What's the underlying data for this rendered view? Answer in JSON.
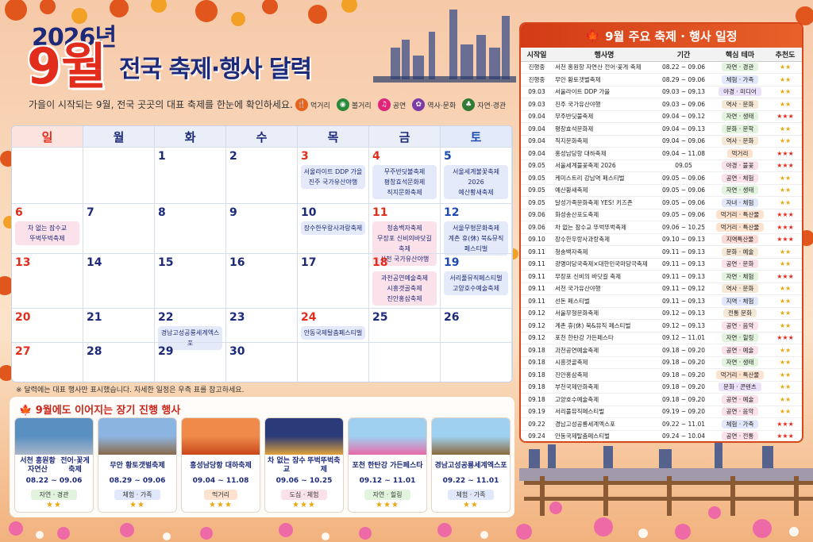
{
  "header": {
    "year": "2026년",
    "month": "9월",
    "title": "전국 축제·행사 달력",
    "subtitle": "가을이 시작되는 9월, 전국 곳곳의 대표 축제를 한눈에 확인하세요."
  },
  "legend": [
    {
      "label": "먹거리",
      "icon": "food-icon",
      "color": "#e8631a",
      "glyph": "🍴"
    },
    {
      "label": "볼거리",
      "icon": "binoculars-icon",
      "color": "#2a8a3a",
      "glyph": "◉"
    },
    {
      "label": "공연",
      "icon": "music-icon",
      "color": "#e0247a",
      "glyph": "♫"
    },
    {
      "label": "역사·문화",
      "icon": "palette-icon",
      "color": "#7a3aa8",
      "glyph": "✿"
    },
    {
      "label": "자연·경관",
      "icon": "tree-icon",
      "color": "#2f7a34",
      "glyph": "♣"
    }
  ],
  "calendar": {
    "weekdays": [
      "일",
      "월",
      "화",
      "수",
      "목",
      "금",
      "토"
    ],
    "days": [
      {
        "d": "",
        "t": ""
      },
      {
        "d": "",
        "t": ""
      },
      {
        "d": "1",
        "t": ""
      },
      {
        "d": "2",
        "t": ""
      },
      {
        "d": "3",
        "t": "hol",
        "ev": "서울라이트 DDP 가을\n진주 국가유산야행",
        "c": "blue"
      },
      {
        "d": "4",
        "t": "hol",
        "ev": "무주반딧불축제\n평창효석문화제\n직지문화축제",
        "c": "blue"
      },
      {
        "d": "5",
        "t": "sat",
        "ev": "서울세계불꽃축제 2026\n예산황새축제",
        "c": "blue"
      },
      {
        "d": "6",
        "t": "sun",
        "ev": "차 없는 잠수교\n뚜벅뚜벅축제",
        "c": "pink"
      },
      {
        "d": "7",
        "t": ""
      },
      {
        "d": "8",
        "t": ""
      },
      {
        "d": "9",
        "t": ""
      },
      {
        "d": "10",
        "t": "",
        "ev": "장수한우랑사과랑축제",
        "c": "blue"
      },
      {
        "d": "11",
        "t": "hol",
        "ev": "청송백자축제\n무장포 신비의바닷길 축제\n서천 국가유산야행",
        "c": "pink"
      },
      {
        "d": "12",
        "t": "sat",
        "ev": "서울무형문화축제\n계촌 휴(休) 북&뮤직\n페스티벌",
        "c": "blue"
      },
      {
        "d": "13",
        "t": "sun"
      },
      {
        "d": "14",
        "t": ""
      },
      {
        "d": "15",
        "t": ""
      },
      {
        "d": "16",
        "t": ""
      },
      {
        "d": "17",
        "t": ""
      },
      {
        "d": "18",
        "t": "hol",
        "ev": "과천공연예술축제\n시흥갯골축제\n진안홍삼축제",
        "c": "pink"
      },
      {
        "d": "19",
        "t": "sat",
        "ev": "서리풀뮤직페스티벌\n고양호수예술축제",
        "c": "blue"
      },
      {
        "d": "20",
        "t": "sun"
      },
      {
        "d": "21",
        "t": ""
      },
      {
        "d": "22",
        "t": "",
        "ev": "경남고성공룡세계엑스포",
        "c": "blue"
      },
      {
        "d": "23",
        "t": ""
      },
      {
        "d": "24",
        "t": "hol",
        "ev": "안동국제탈춤페스티벌",
        "c": "blue"
      },
      {
        "d": "25",
        "t": ""
      },
      {
        "d": "26",
        "t": ""
      },
      {
        "d": "27",
        "t": "sun"
      },
      {
        "d": "28",
        "t": ""
      },
      {
        "d": "29",
        "t": ""
      },
      {
        "d": "30",
        "t": ""
      },
      {
        "d": "",
        "t": ""
      },
      {
        "d": "",
        "t": ""
      },
      {
        "d": "",
        "t": ""
      }
    ]
  },
  "note": "※ 달력에는 대표 행사만 표시했습니다. 자세한 일정은 우측 표를 참고하세요.",
  "long_events": {
    "title": "9월에도 이어지는 장기 진행 행사",
    "items": [
      {
        "name": "서천 홍원항 자연산\n전어·꽃게 축제",
        "date": "08.22 ~ 09.06",
        "theme": "자연 · 경관",
        "stars": "★★",
        "theme_color": "#e3f4de",
        "img": "fish"
      },
      {
        "name": "무안 황토갯벌축제",
        "date": "08.29 ~ 09.06",
        "theme": "체험 · 가족",
        "stars": "★★",
        "theme_color": "#e1e8fb",
        "img": "mudflat"
      },
      {
        "name": "홍성남당항 대하축제",
        "date": "09.04 ~ 11.08",
        "theme": "먹거리",
        "stars": "★★★",
        "theme_color": "#fde3cf",
        "img": "shrimp"
      },
      {
        "name": "차 없는 잠수교\n뚜벅뚜벅축제",
        "date": "09.06 ~ 10.25",
        "theme": "도심 · 체험",
        "stars": "★★★",
        "theme_color": "#fbe1ea",
        "img": "bridge"
      },
      {
        "name": "포천 한탄강 가든페스타",
        "date": "09.12 ~ 11.01",
        "theme": "자연 · 힐링",
        "stars": "★★★",
        "theme_color": "#e3f4de",
        "img": "garden"
      },
      {
        "name": "경남고성공룡세계엑스포",
        "date": "09.22 ~ 11.01",
        "theme": "체험 · 가족",
        "stars": "★★",
        "theme_color": "#e1e8fb",
        "img": "dino"
      }
    ]
  },
  "schedule": {
    "title": "9월 주요 축제 · 행사 일정",
    "columns": [
      "시작일",
      "행사명",
      "기간",
      "핵심 테마",
      "추천도"
    ],
    "rows": [
      [
        "진행중",
        "서천 홍원항 자연산 전어·꽃게 축제",
        "08.22 ~ 09.06",
        "자연 · 경관",
        "★★",
        "t-green",
        ""
      ],
      [
        "진행중",
        "무안 황토갯벌축제",
        "08.29 ~ 09.06",
        "체험 · 가족",
        "★★",
        "t-blue",
        ""
      ],
      [
        "09.03",
        "서울라이트 DDP 가을",
        "09.03 ~ 09.13",
        "야경 · 미디어",
        "★★",
        "t-purple",
        ""
      ],
      [
        "09.03",
        "진주 국가유산야행",
        "09.03 ~ 09.06",
        "역사 · 문화",
        "★★",
        "t-brown",
        ""
      ],
      [
        "09.04",
        "무주반딧불축제",
        "09.04 ~ 09.12",
        "자연 · 생태",
        "★★★",
        "t-green",
        "red"
      ],
      [
        "09.04",
        "평창효석문화제",
        "09.04 ~ 09.13",
        "문화 · 문학",
        "★★",
        "t-green",
        ""
      ],
      [
        "09.04",
        "직지문화축제",
        "09.04 ~ 09.06",
        "역사 · 문화",
        "★★",
        "t-brown",
        ""
      ],
      [
        "09.04",
        "홍성남당항 대하축제",
        "09.04 ~ 11.08",
        "먹거리",
        "★★★",
        "t-orange",
        "red"
      ],
      [
        "09.05",
        "서울세계불꽃축제 2026",
        "09.05",
        "야경 · 불꽃",
        "★★★",
        "t-pink",
        "red"
      ],
      [
        "09.05",
        "케미스트리 강남역 페스티벌",
        "09.05 ~ 09.06",
        "공연 · 체험",
        "★★",
        "t-pink",
        ""
      ],
      [
        "09.05",
        "예산황새축제",
        "09.05 ~ 09.06",
        "자연 · 생태",
        "★★",
        "t-green",
        ""
      ],
      [
        "09.05",
        "달성가족문화축제 YES! 키즈존",
        "09.05 ~ 09.06",
        "자녀 · 체험",
        "★★",
        "t-blue",
        ""
      ],
      [
        "09.06",
        "화성송산포도축제",
        "09.05 ~ 09.06",
        "먹거리 · 특산물",
        "★★★",
        "t-orange",
        "red"
      ],
      [
        "09.06",
        "차 없는 잠수교 뚜벅뚜벅축제",
        "09.06 ~ 10.25",
        "먹거리 · 특산물",
        "★★★",
        "t-orange",
        "red"
      ],
      [
        "09.10",
        "장수한우랑사과랑축제",
        "09.10 ~ 09.13",
        "지역특산물",
        "★★★",
        "t-red",
        "red"
      ],
      [
        "09.11",
        "청송백자축제",
        "09.11 ~ 09.13",
        "문화 · 예술",
        "★★",
        "t-brown",
        ""
      ],
      [
        "09.11",
        "광명미당국축제×대한민국마당극축제",
        "09.11 ~ 09.13",
        "공연 · 문화",
        "★★",
        "t-pink",
        ""
      ],
      [
        "09.11",
        "무장포 신비의 바닷길 축제",
        "09.11 ~ 09.13",
        "자연 · 체험",
        "★★★",
        "t-green",
        "red"
      ],
      [
        "09.11",
        "서천 국가유산야행",
        "09.11 ~ 09.12",
        "역사 · 문화",
        "★★",
        "t-brown",
        ""
      ],
      [
        "09.11",
        "선돈 페스티벌",
        "09.11 ~ 09.13",
        "지역 · 체험",
        "★★",
        "t-blue",
        ""
      ],
      [
        "09.12",
        "서울무형문화축제",
        "09.12 ~ 09.13",
        "전통 문화",
        "★★",
        "t-brown",
        ""
      ],
      [
        "09.12",
        "계촌 휴(休) 북&뮤직 페스티벌",
        "09.12 ~ 09.13",
        "공연 · 음악",
        "★★",
        "t-pink",
        ""
      ],
      [
        "09.12",
        "포천 한탄강 가든페스타",
        "09.12 ~ 11.01",
        "자연 · 힐링",
        "★★★",
        "t-green",
        "red"
      ],
      [
        "09.18",
        "과천공연예술축제",
        "09.18 ~ 09.20",
        "공연 · 예술",
        "★★",
        "t-pink",
        ""
      ],
      [
        "09.18",
        "시흥갯골축제",
        "09.18 ~ 09.20",
        "자연 · 생태",
        "★★",
        "t-green",
        ""
      ],
      [
        "09.18",
        "진안홍삼축제",
        "09.18 ~ 09.20",
        "먹거리 · 특산물",
        "★★",
        "t-orange",
        ""
      ],
      [
        "09.18",
        "부천국제만화축제",
        "09.18 ~ 09.20",
        "문화 · 콘텐츠",
        "★★",
        "t-purple",
        ""
      ],
      [
        "09.18",
        "고양호수예술축제",
        "09.18 ~ 09.20",
        "공연 · 예술",
        "★★",
        "t-pink",
        ""
      ],
      [
        "09.19",
        "서리풀뮤직페스티벌",
        "09.19 ~ 09.20",
        "공연 · 음악",
        "★★",
        "t-pink",
        ""
      ],
      [
        "09.22",
        "경남고성공룡세계엑스포",
        "09.22 ~ 11.01",
        "체험 · 가족",
        "★★★",
        "t-blue",
        "red"
      ],
      [
        "09.24",
        "안동국제탈춤페스티벌",
        "09.24 ~ 10.04",
        "공연 · 전통",
        "★★★",
        "t-pink",
        "red"
      ]
    ]
  }
}
